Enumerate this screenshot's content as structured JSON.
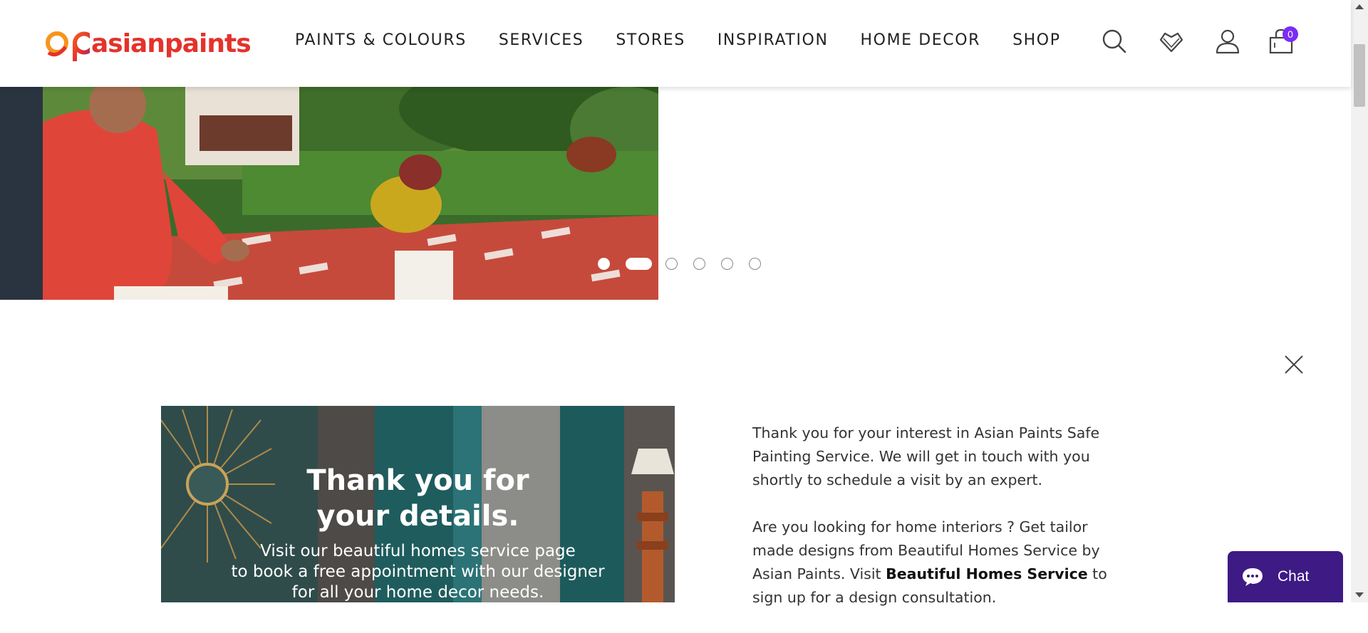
{
  "brand": {
    "name": "asianpaints",
    "accent": "#e4322b"
  },
  "nav": {
    "items": [
      {
        "label": "PAINTS & COLOURS"
      },
      {
        "label": "SERVICES"
      },
      {
        "label": "STORES"
      },
      {
        "label": "INSPIRATION"
      },
      {
        "label": "HOME DECOR"
      },
      {
        "label": "SHOP"
      }
    ]
  },
  "header_icons": {
    "search": "search-icon",
    "wishlist": "heart-icon",
    "account": "user-icon",
    "cart": "cart-icon",
    "cart_count": "0"
  },
  "carousel": {
    "slide_count": 6,
    "active_index": 1
  },
  "thank_you": {
    "title_line1": "Thank you for",
    "title_line2": "your details.",
    "sub_line1": "Visit our beautiful homes service page",
    "sub_line2": "to book a free appointment with our designer",
    "sub_line3": "for all your home decor needs."
  },
  "message": {
    "para1": "Thank you for your interest in Asian Paints Safe Painting Service. We will get in touch with you shortly to schedule a visit by an expert.",
    "para2_before": "Are you looking for home interiors ? Get tailor made designs from Beautiful Homes Service by Asian Paints. Visit ",
    "para2_link": "Beautiful Homes Service",
    "para2_after": " to sign up for a design consultation."
  },
  "chat": {
    "label": "Chat",
    "color": "#3e1a84"
  }
}
